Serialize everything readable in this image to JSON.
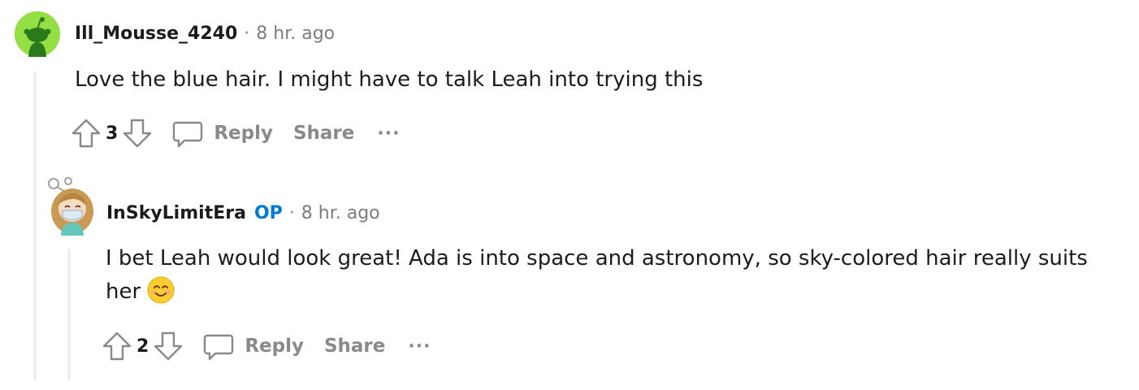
{
  "comments": [
    {
      "username": "Ill_Mousse_4240",
      "separator": "·",
      "time": "8 hr. ago",
      "body": "Love the blue hair. I might have to talk Leah into trying this",
      "score": "3",
      "reply_label": "Reply",
      "share_label": "Share",
      "more_label": "···",
      "avatar_color": "#94e044"
    },
    {
      "username": "InSkyLimitEra",
      "op_badge": "OP",
      "separator": "·",
      "time": "8 hr. ago",
      "body": "I bet Leah would look great! Ada is into space and astronomy, so sky-colored hair really suits her",
      "score": "2",
      "reply_label": "Reply",
      "share_label": "Share",
      "more_label": "···",
      "emoji": "smiling-face-icon"
    }
  ],
  "colors": {
    "thread_line": "#edeff1",
    "op_accent": "#0079d3",
    "muted": "#878a8c"
  }
}
